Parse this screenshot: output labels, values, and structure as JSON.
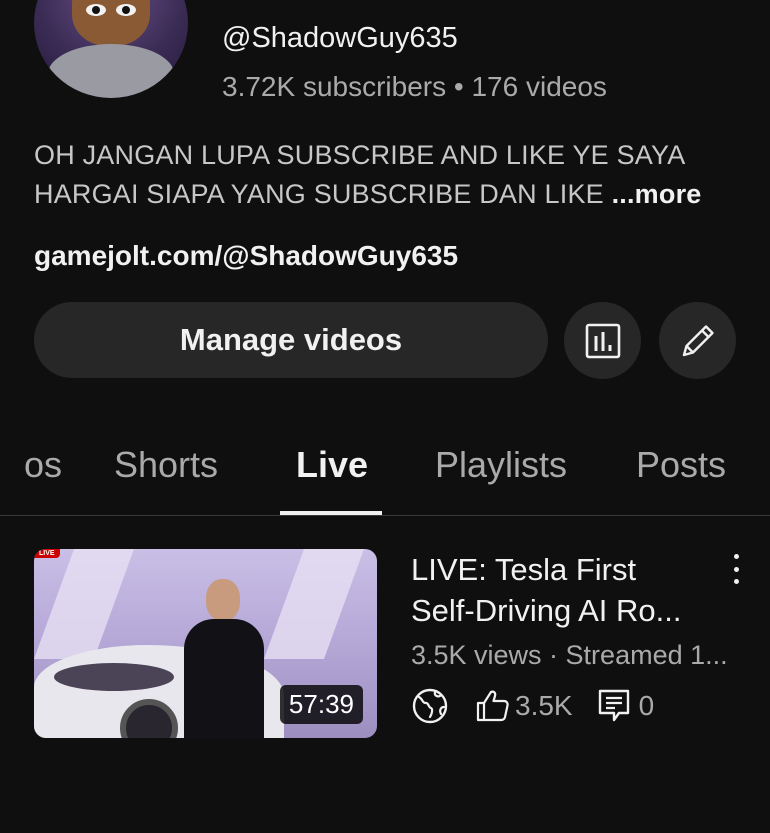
{
  "channel": {
    "handle": "@ShadowGuy635",
    "stats": "3.72K subscribers • 176 videos",
    "description_line1": "OH JANGAN LUPA SUBSCRIBE AND LIKE YE SAYA",
    "description_line2": "HARGAI SIAPA YANG SUBSCRIBE DAN LIKE ",
    "more_label": "...more",
    "link": "gamejolt.com/@ShadowGuy635"
  },
  "actions": {
    "manage_label": "Manage videos",
    "analytics_icon": "analytics-icon",
    "edit_icon": "pencil-icon"
  },
  "tabs": [
    {
      "label": "os"
    },
    {
      "label": "Shorts"
    },
    {
      "label": "Live",
      "active": true
    },
    {
      "label": "Playlists"
    },
    {
      "label": "Posts"
    }
  ],
  "video": {
    "live_badge": "LIVE",
    "duration": "57:39",
    "title_line1": "LIVE: Tesla First",
    "title_line2": "Self-Driving AI Ro...",
    "meta": "3.5K views · Streamed 1...",
    "likes": "3.5K",
    "comments": "0"
  },
  "colors": {
    "background": "#0f0f0f",
    "surface": "#272727",
    "primary_text": "#f1f1f1",
    "secondary_text": "#aaaaaa"
  }
}
